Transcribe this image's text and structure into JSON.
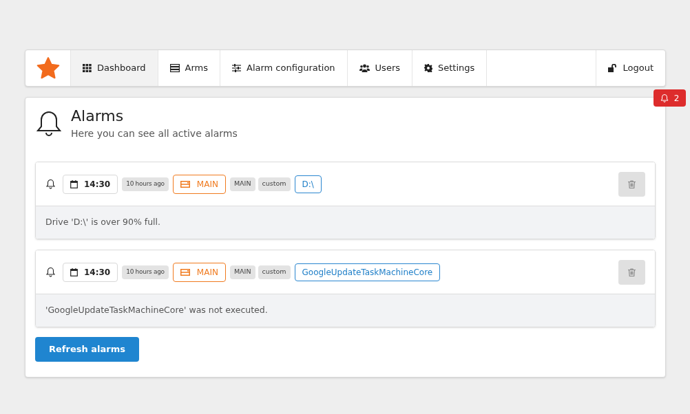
{
  "nav": {
    "items": [
      {
        "label": "Dashboard",
        "kind": "grid",
        "selected": true
      },
      {
        "label": "Arms",
        "kind": "server",
        "selected": false
      },
      {
        "label": "Alarm configuration",
        "kind": "sliders",
        "selected": false
      },
      {
        "label": "Users",
        "kind": "users",
        "selected": false
      },
      {
        "label": "Settings",
        "kind": "gear",
        "selected": false
      }
    ],
    "logout": "Logout"
  },
  "alarm_badge": {
    "count": "2"
  },
  "header": {
    "title": "Alarms",
    "subtitle": "Here you can see all active alarms"
  },
  "alarms": [
    {
      "time": "14:30",
      "ago": "10 hours ago",
      "arm": "MAIN",
      "tags": [
        "MAIN",
        "custom"
      ],
      "target": "D:\\",
      "message": "Drive 'D:\\' is over 90% full."
    },
    {
      "time": "14:30",
      "ago": "10 hours ago",
      "arm": "MAIN",
      "tags": [
        "MAIN",
        "custom"
      ],
      "target": "GoogleUpdateTaskMachineCore",
      "message": "'GoogleUpdateTaskMachineCore' was not executed."
    }
  ],
  "refresh_button": "Refresh alarms"
}
